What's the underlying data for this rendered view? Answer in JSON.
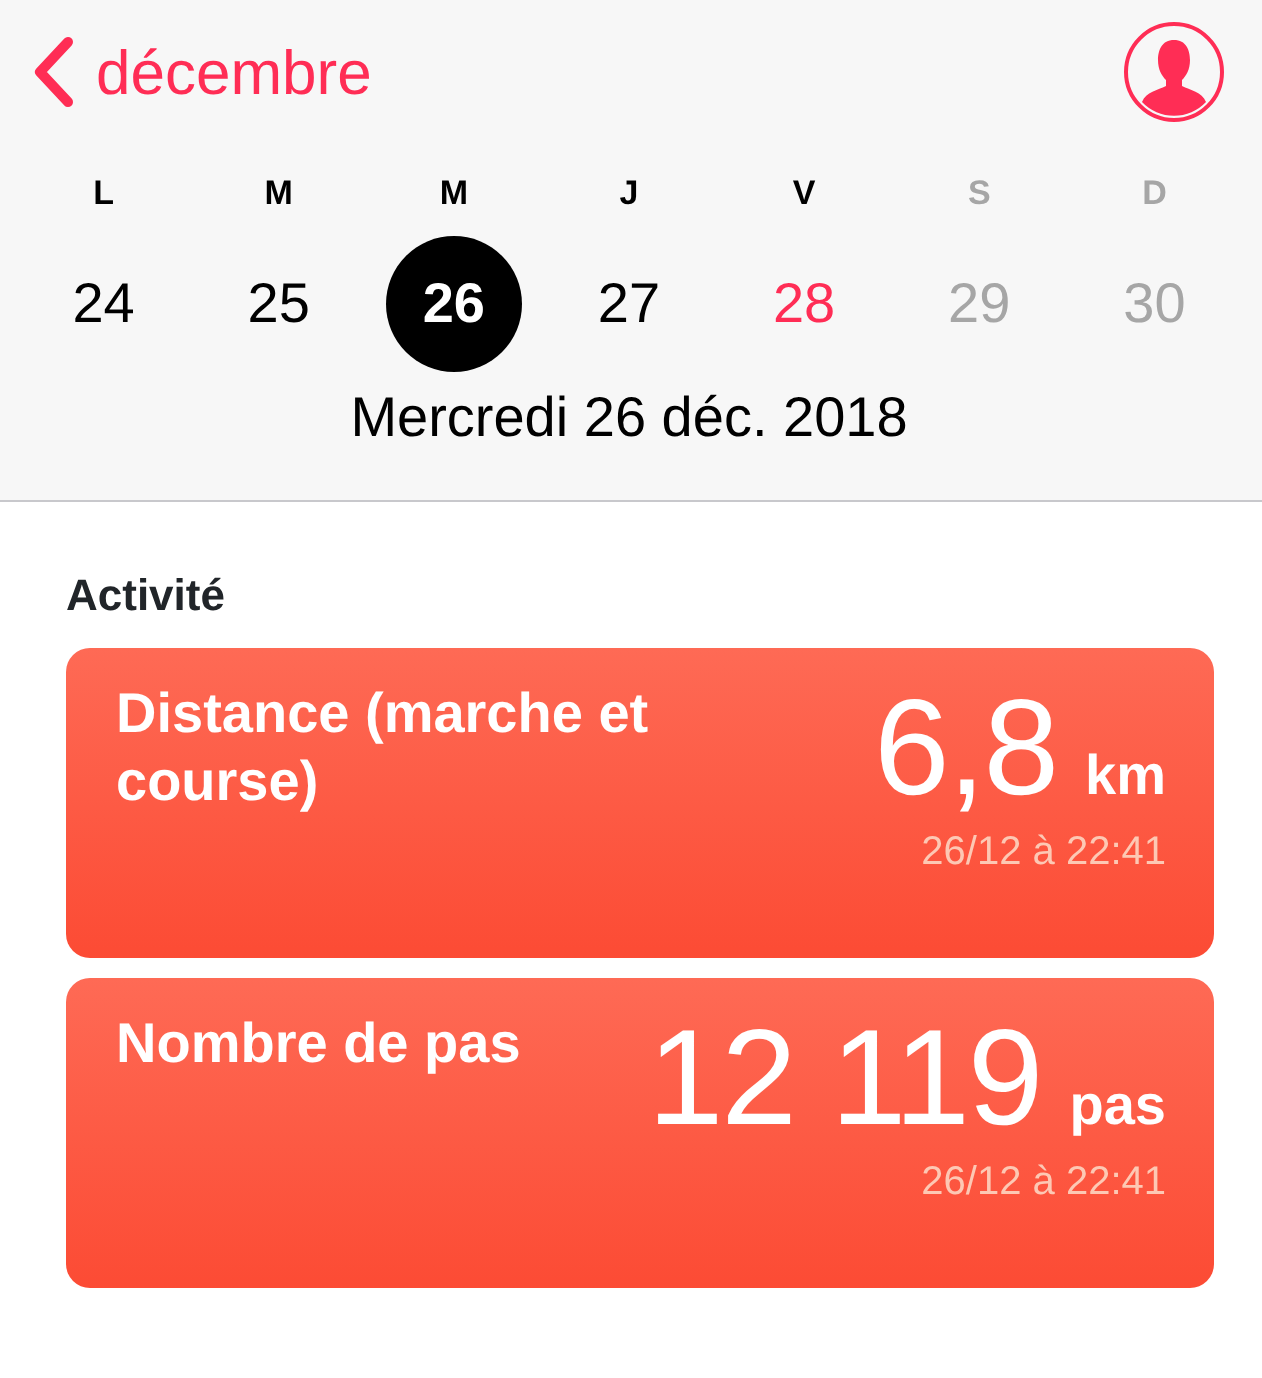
{
  "header": {
    "back_label": "décembre"
  },
  "week": [
    {
      "letter": "L",
      "day": "24",
      "selected": false,
      "today": false,
      "dimmed": false
    },
    {
      "letter": "M",
      "day": "25",
      "selected": false,
      "today": false,
      "dimmed": false
    },
    {
      "letter": "M",
      "day": "26",
      "selected": true,
      "today": false,
      "dimmed": false
    },
    {
      "letter": "J",
      "day": "27",
      "selected": false,
      "today": false,
      "dimmed": false
    },
    {
      "letter": "V",
      "day": "28",
      "selected": false,
      "today": true,
      "dimmed": false
    },
    {
      "letter": "S",
      "day": "29",
      "selected": false,
      "today": false,
      "dimmed": true
    },
    {
      "letter": "D",
      "day": "30",
      "selected": false,
      "today": false,
      "dimmed": true
    }
  ],
  "selected_date": "Mercredi 26 déc. 2018",
  "section_title": "Activité",
  "cards": [
    {
      "label": "Distance (marche et course)",
      "value": "6,8",
      "unit": "km",
      "timestamp": "26/12 à 22:41"
    },
    {
      "label": "Nombre de pas",
      "value": "12 119",
      "unit": "pas",
      "timestamp": "26/12 à 22:41"
    }
  ]
}
